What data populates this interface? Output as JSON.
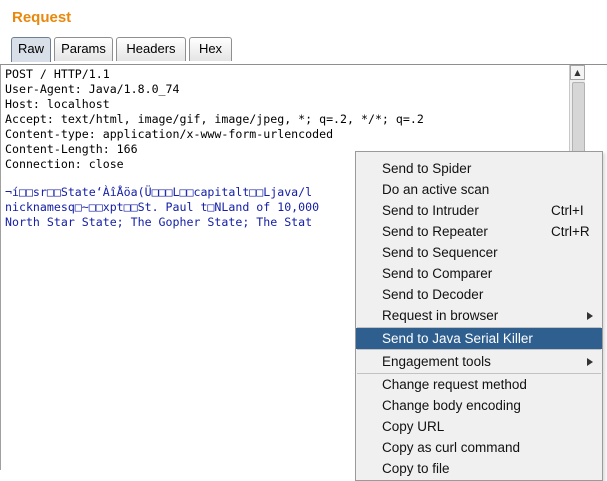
{
  "panel": {
    "title": "Request"
  },
  "tabs": [
    {
      "label": "Raw",
      "active": true
    },
    {
      "label": "Params",
      "active": false
    },
    {
      "label": "Headers",
      "active": false
    },
    {
      "label": "Hex",
      "active": false
    }
  ],
  "editor": {
    "lines": [
      "POST / HTTP/1.1",
      "User-Agent: Java/1.8.0_74",
      "Host: localhost",
      "Accept: text/html, image/gif, image/jpeg, *; q=.2, */*; q=.2",
      "Content-type: application/x-www-form-urlencoded",
      "Content-Length: 166",
      "Connection: close",
      ""
    ],
    "body_lines": [
      "¬í□□sr□□State‘ÀîÅöa(Ü□□□L□□capitalt□□Ljava/l",
      "nicknamesq□~□□xpt□□St. Paul t□NLand of 10,000",
      "North Star State; The Gopher State; The Stat"
    ]
  },
  "context_menu": {
    "items": [
      {
        "label": "Send to Spider",
        "shortcut": "",
        "submenu": false
      },
      {
        "label": "Do an active scan",
        "shortcut": "",
        "submenu": false
      },
      {
        "label": "Send to Intruder",
        "shortcut": "Ctrl+I",
        "submenu": false
      },
      {
        "label": "Send to Repeater",
        "shortcut": "Ctrl+R",
        "submenu": false
      },
      {
        "label": "Send to Sequencer",
        "shortcut": "",
        "submenu": false
      },
      {
        "label": "Send to Comparer",
        "shortcut": "",
        "submenu": false
      },
      {
        "label": "Send to Decoder",
        "shortcut": "",
        "submenu": false
      },
      {
        "label": "Request in browser",
        "shortcut": "",
        "submenu": true
      },
      {
        "label": "Send to Java Serial Killer",
        "shortcut": "",
        "submenu": false,
        "selected": true
      },
      {
        "label": "Engagement tools",
        "shortcut": "",
        "submenu": true
      },
      {
        "label": "Change request method",
        "shortcut": "",
        "submenu": false
      },
      {
        "label": "Change body encoding",
        "shortcut": "",
        "submenu": false
      },
      {
        "label": "Copy URL",
        "shortcut": "",
        "submenu": false
      },
      {
        "label": "Copy as curl command",
        "shortcut": "",
        "submenu": false
      },
      {
        "label": "Copy to file",
        "shortcut": "",
        "submenu": false
      }
    ]
  },
  "colors": {
    "title": "#e8880c",
    "selected_menu_bg": "#2e5f8f",
    "body_text": "#1520a6"
  }
}
